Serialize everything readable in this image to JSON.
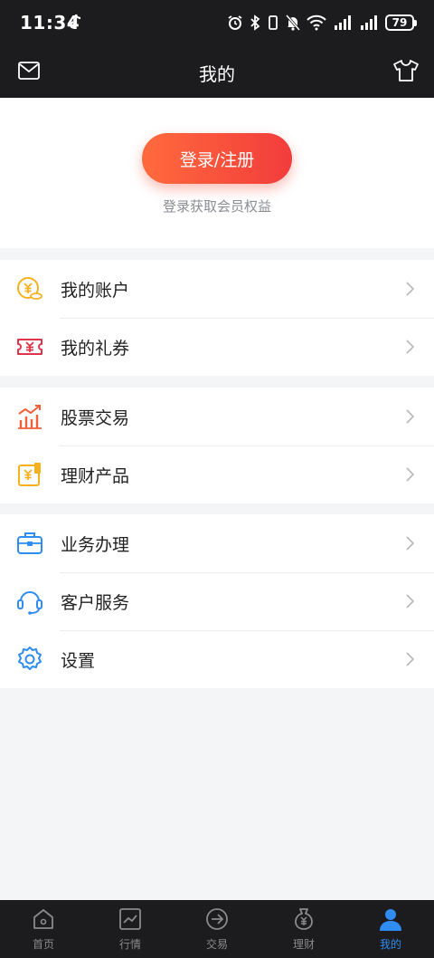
{
  "status_bar": {
    "time": "11:34",
    "battery": "79"
  },
  "header": {
    "title": "我的"
  },
  "login": {
    "button_label": "登录/注册",
    "hint": "登录获取会员权益"
  },
  "menu_groups": [
    {
      "items": [
        {
          "label": "我的账户",
          "icon": "account-coin-icon"
        },
        {
          "label": "我的礼券",
          "icon": "coupon-icon"
        }
      ]
    },
    {
      "items": [
        {
          "label": "股票交易",
          "icon": "stock-chart-icon"
        },
        {
          "label": "理财产品",
          "icon": "finance-product-icon"
        }
      ]
    },
    {
      "items": [
        {
          "label": "业务办理",
          "icon": "briefcase-icon"
        },
        {
          "label": "客户服务",
          "icon": "headset-icon"
        },
        {
          "label": "设置",
          "icon": "gear-icon"
        }
      ]
    }
  ],
  "tabs": [
    {
      "label": "首页",
      "icon": "home-icon"
    },
    {
      "label": "行情",
      "icon": "market-chart-icon"
    },
    {
      "label": "交易",
      "icon": "trade-icon"
    },
    {
      "label": "理财",
      "icon": "money-bag-icon"
    },
    {
      "label": "我的",
      "icon": "user-icon",
      "active": true
    }
  ],
  "colors": {
    "accent_blue": "#2f8cf0",
    "login_gradient_start": "#ff6a3d",
    "login_gradient_end": "#f23c3c",
    "dark_bar": "#1c1c1e"
  }
}
